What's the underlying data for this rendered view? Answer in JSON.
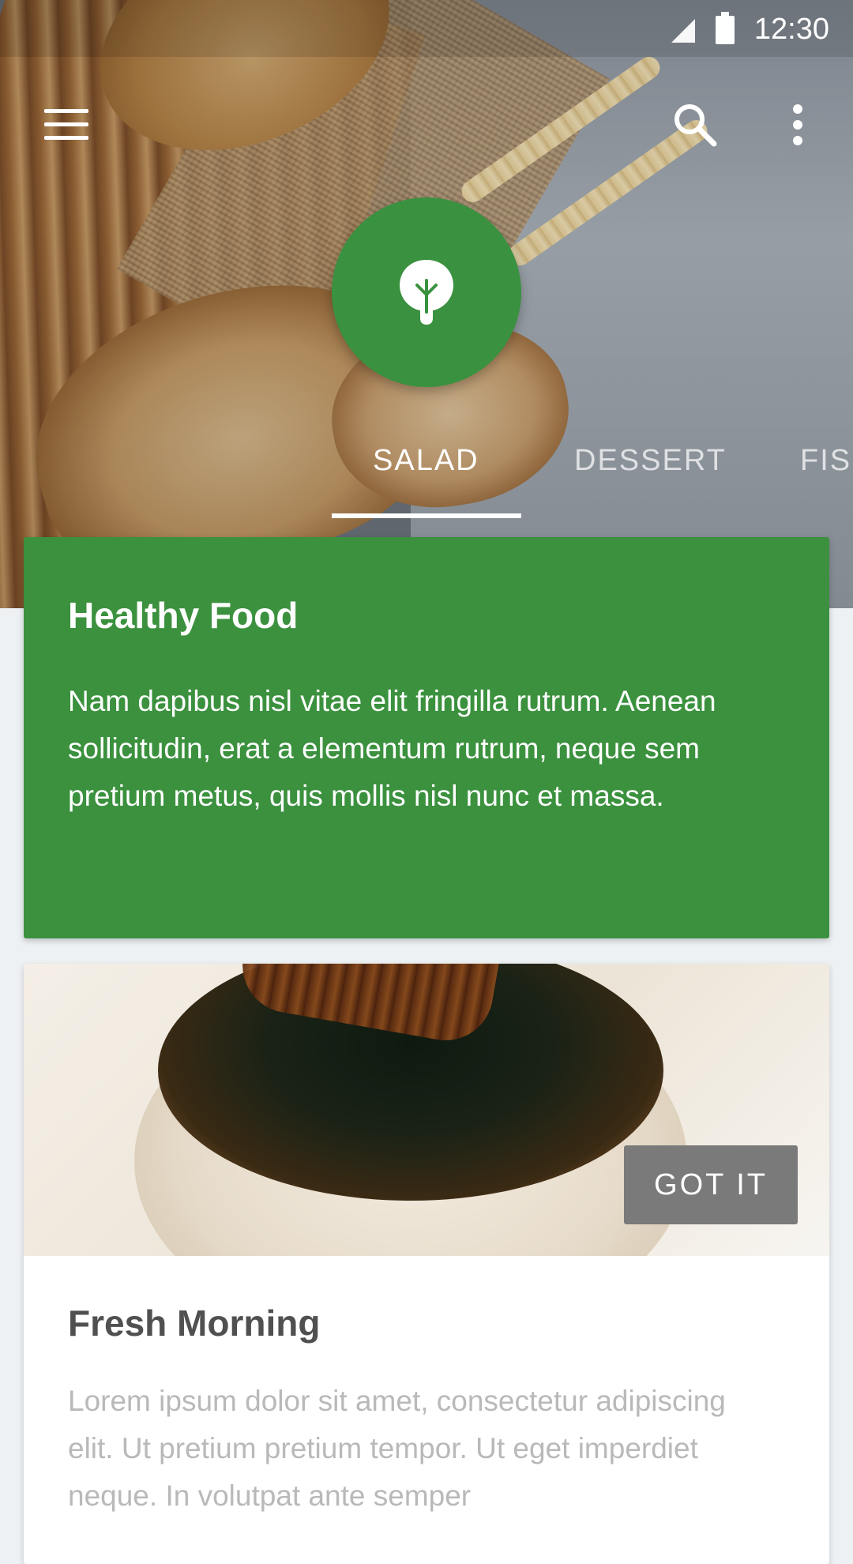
{
  "status_bar": {
    "time": "12:30"
  },
  "app_bar": {
    "menu_icon": "menu-icon",
    "search_icon": "search-icon",
    "more_icon": "more-vert-icon"
  },
  "category_icon": "leaf-icon",
  "tabs": [
    {
      "label": "SALAD",
      "active": true
    },
    {
      "label": "DESSERT",
      "active": false
    },
    {
      "label": "FIS",
      "active": false
    }
  ],
  "feature_card": {
    "title": "Healthy Food",
    "body": "Nam dapibus nisl vitae elit fringilla rutrum. Aenean sollicitudin, erat a elementum rutrum, neque sem pretium metus, quis mollis nisl nunc et massa."
  },
  "photo_card": {
    "button_label": "GOT IT",
    "title": "Fresh Morning",
    "body": "Lorem ipsum dolor sit amet, consectetur adipiscing elit. Ut pretium pretium tempor. Ut eget imperdiet neque. In volutpat ante semper"
  },
  "colors": {
    "primary_green": "#3b913e",
    "button_grey": "#7a7a7a",
    "background": "#eef1f4"
  }
}
